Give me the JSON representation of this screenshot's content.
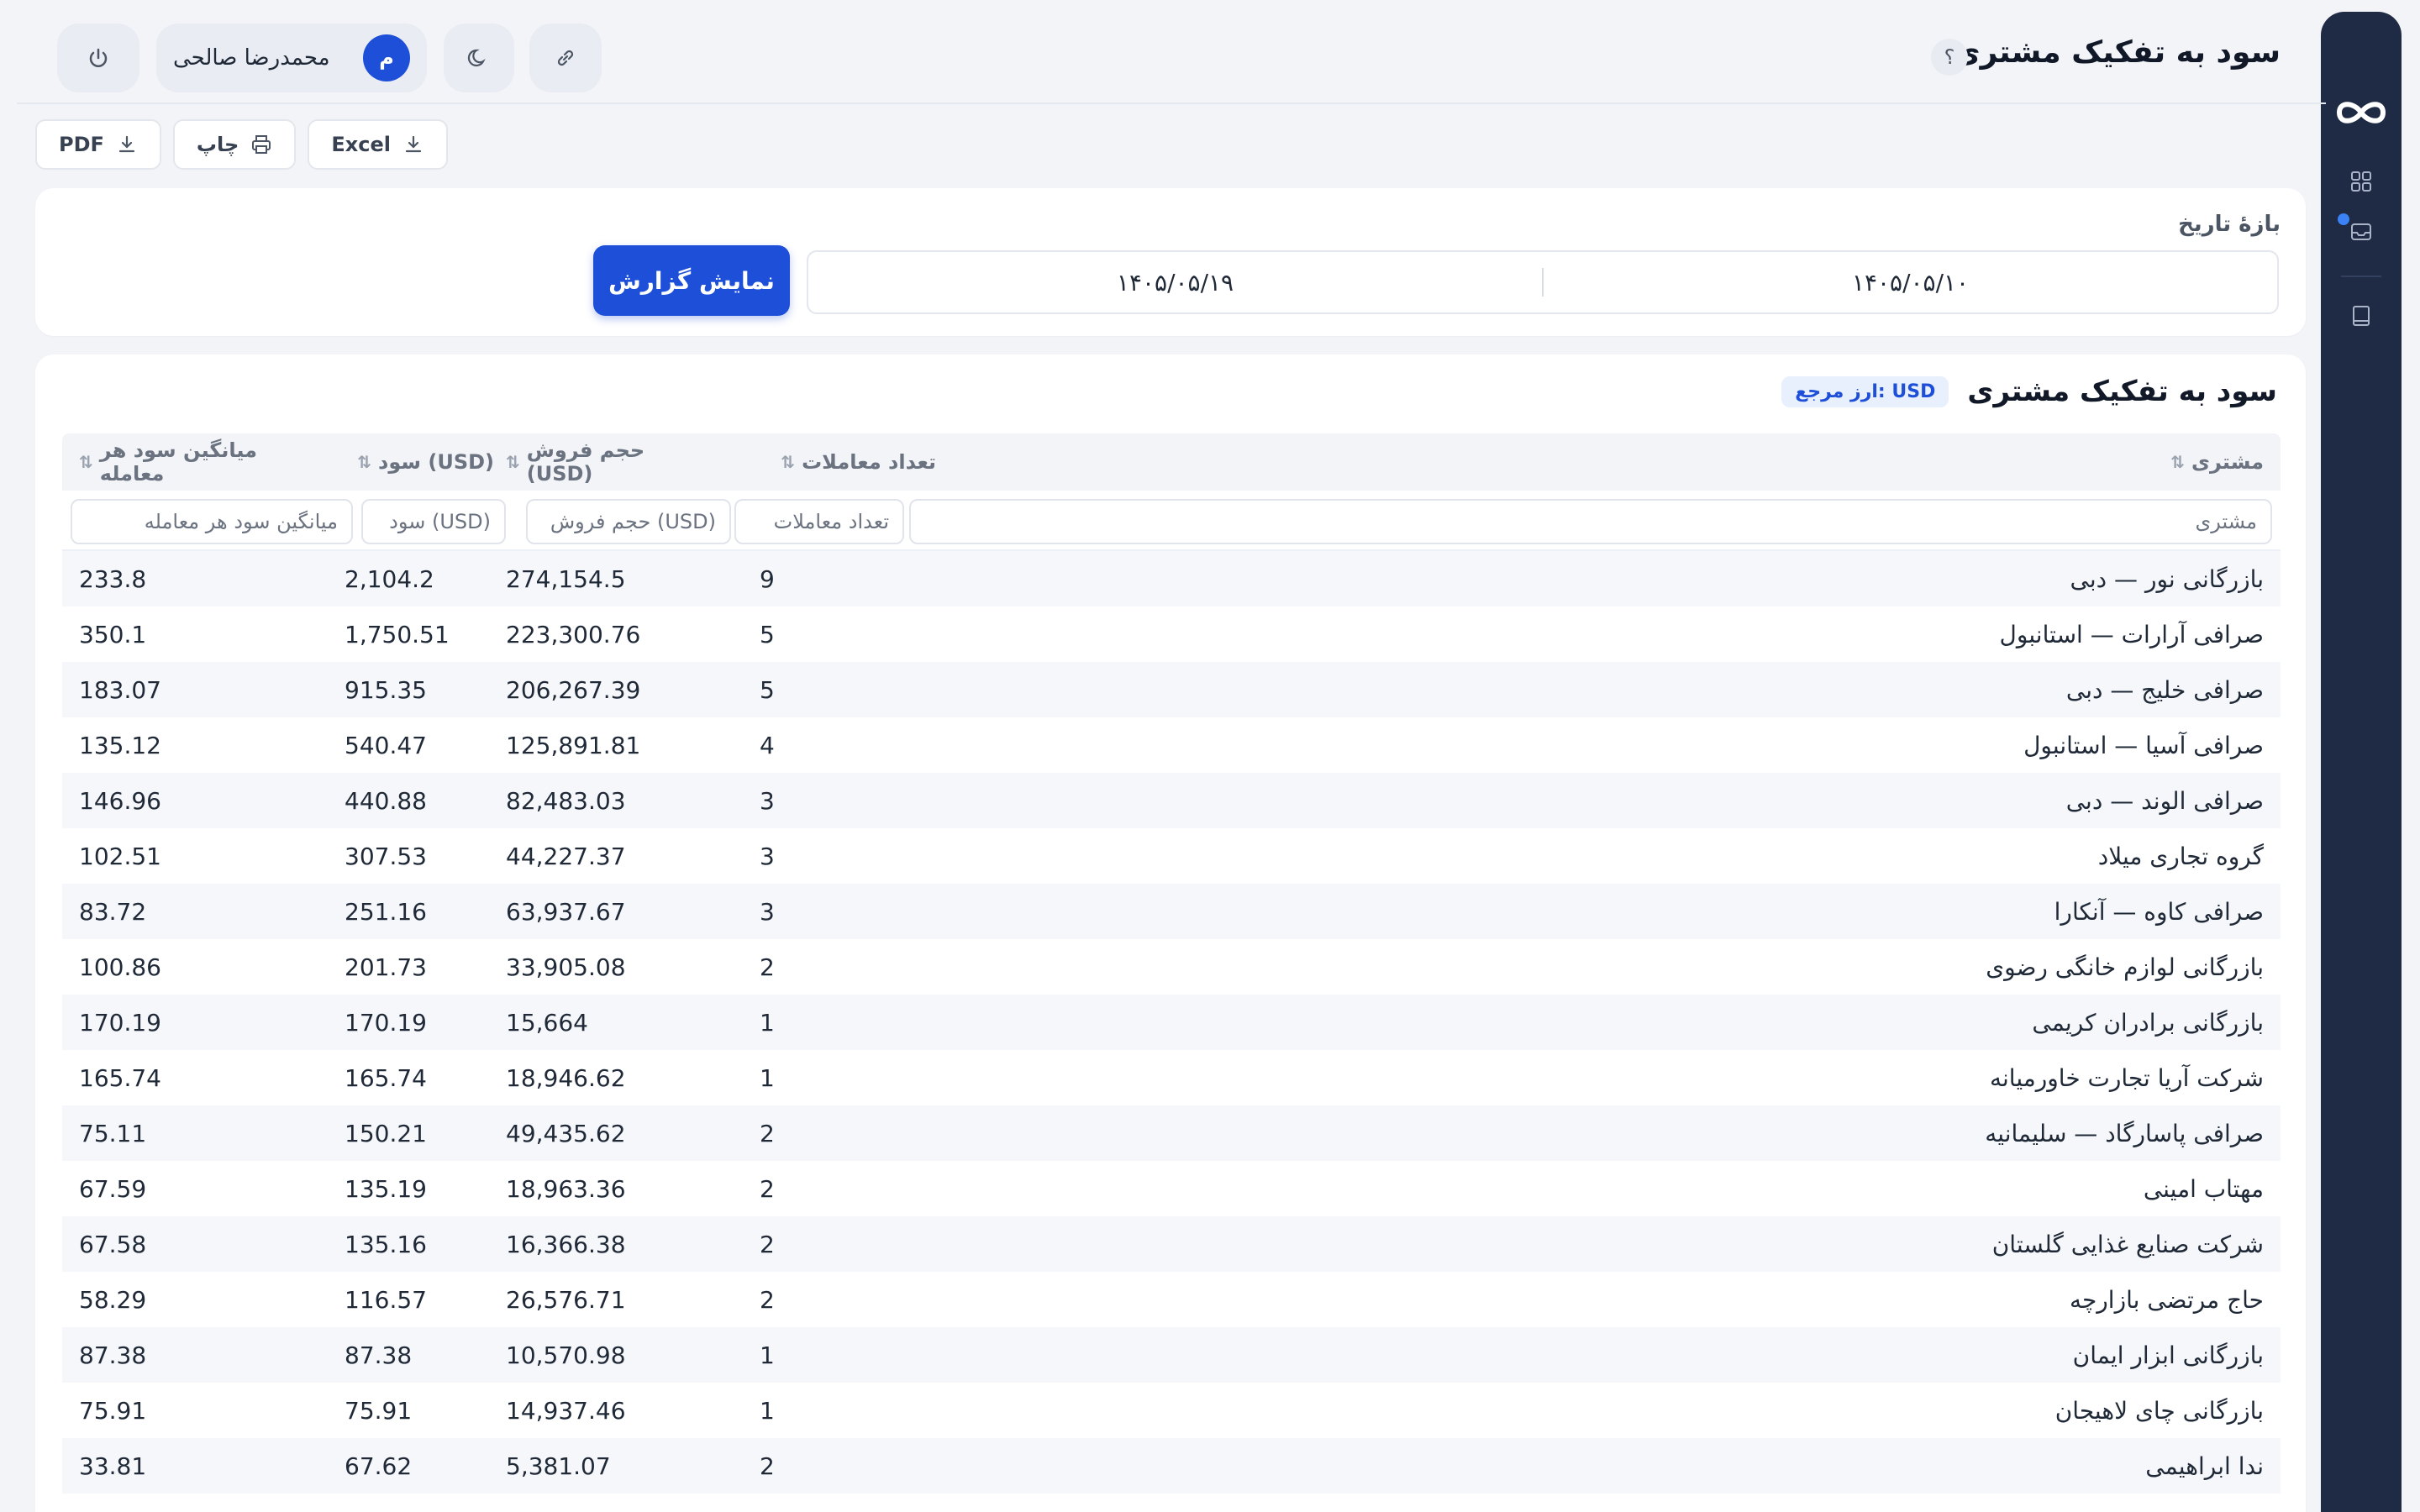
{
  "app": {
    "page_title": "سود به تفکیک مشتری",
    "help_label": "؟",
    "user_name": "محمدرضا صالحی",
    "user_initial": "م"
  },
  "toolbar": {
    "excel_label": "Excel",
    "print_label": "چاپ",
    "pdf_label": "PDF"
  },
  "filter": {
    "label": "بازهٔ تاریخ",
    "date_from": "۱۴۰۵/۰۵/۱۰",
    "date_to": "۱۴۰۵/۰۵/۱۹",
    "submit_label": "نمایش گزارش"
  },
  "report": {
    "title": "سود به تفکیک مشتری",
    "currency_badge": "ارز مرجع: USD",
    "columns": {
      "customer": "مشتری",
      "trades": "تعداد معاملات",
      "volume": "حجم فروش (USD)",
      "profit": "سود (USD)",
      "avg": "میانگین سود هر معامله"
    },
    "filters": {
      "customer": "مشتری",
      "trades": "تعداد معاملات",
      "volume": "حجم فروش (USD)",
      "profit": "سود (USD)",
      "avg": "میانگین سود هر معامله"
    },
    "rows": [
      {
        "customer": "بازرگانی نور — دبی",
        "trades": "9",
        "volume": "274,154.5",
        "profit": "2,104.2",
        "avg": "233.8"
      },
      {
        "customer": "صرافی آرارات — استانبول",
        "trades": "5",
        "volume": "223,300.76",
        "profit": "1,750.51",
        "avg": "350.1"
      },
      {
        "customer": "صرافی خلیج — دبی",
        "trades": "5",
        "volume": "206,267.39",
        "profit": "915.35",
        "avg": "183.07"
      },
      {
        "customer": "صرافی آسیا — استانبول",
        "trades": "4",
        "volume": "125,891.81",
        "profit": "540.47",
        "avg": "135.12"
      },
      {
        "customer": "صرافی الوند — دبی",
        "trades": "3",
        "volume": "82,483.03",
        "profit": "440.88",
        "avg": "146.96"
      },
      {
        "customer": "گروه تجاری میلاد",
        "trades": "3",
        "volume": "44,227.37",
        "profit": "307.53",
        "avg": "102.51"
      },
      {
        "customer": "صرافی کاوه — آنکارا",
        "trades": "3",
        "volume": "63,937.67",
        "profit": "251.16",
        "avg": "83.72"
      },
      {
        "customer": "بازرگانی لوازم خانگی رضوی",
        "trades": "2",
        "volume": "33,905.08",
        "profit": "201.73",
        "avg": "100.86"
      },
      {
        "customer": "بازرگانی برادران کریمی",
        "trades": "1",
        "volume": "15,664",
        "profit": "170.19",
        "avg": "170.19"
      },
      {
        "customer": "شرکت آریا تجارت خاورمیانه",
        "trades": "1",
        "volume": "18,946.62",
        "profit": "165.74",
        "avg": "165.74"
      },
      {
        "customer": "صرافی پاسارگاد — سلیمانیه",
        "trades": "2",
        "volume": "49,435.62",
        "profit": "150.21",
        "avg": "75.11"
      },
      {
        "customer": "مهتاب امینی",
        "trades": "2",
        "volume": "18,963.36",
        "profit": "135.19",
        "avg": "67.59"
      },
      {
        "customer": "شرکت صنایع غذایی گلستان",
        "trades": "2",
        "volume": "16,366.38",
        "profit": "135.16",
        "avg": "67.58"
      },
      {
        "customer": "حاج مرتضی بازارچه",
        "trades": "2",
        "volume": "26,576.71",
        "profit": "116.57",
        "avg": "58.29"
      },
      {
        "customer": "بازرگانی ابزار ایمان",
        "trades": "1",
        "volume": "10,570.98",
        "profit": "87.38",
        "avg": "87.38"
      },
      {
        "customer": "بازرگانی چای لاهیجان",
        "trades": "1",
        "volume": "14,937.46",
        "profit": "75.91",
        "avg": "75.91"
      },
      {
        "customer": "ندا ابراهیمی",
        "trades": "2",
        "volume": "5,381.07",
        "profit": "67.62",
        "avg": "33.81"
      }
    ]
  },
  "colors": {
    "primary": "#1d4fd8",
    "profit": "#1e8a4f",
    "rail": "#1f2a44"
  }
}
